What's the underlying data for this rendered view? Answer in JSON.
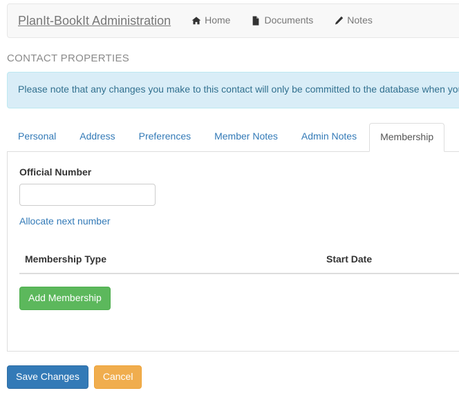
{
  "navbar": {
    "brand": "PlanIt-BookIt Administration",
    "links": [
      {
        "label": "Home",
        "icon": "home-icon"
      },
      {
        "label": "Documents",
        "icon": "file-icon"
      },
      {
        "label": "Notes",
        "icon": "pencil-icon"
      }
    ]
  },
  "page": {
    "title": "CONTACT PROPERTIES"
  },
  "alert": {
    "type": "info",
    "text": "Please note that any changes you make to this contact will only be committed to the database when you",
    "bg_color": "#d9edf7",
    "text_color": "#31708f"
  },
  "tabs": {
    "items": [
      {
        "label": "Personal",
        "active": false
      },
      {
        "label": "Address",
        "active": false
      },
      {
        "label": "Preferences",
        "active": false
      },
      {
        "label": "Member Notes",
        "active": false
      },
      {
        "label": "Admin Notes",
        "active": false
      },
      {
        "label": "Membership",
        "active": true
      }
    ],
    "active_label": "Membership"
  },
  "membership": {
    "official_number_label": "Official Number",
    "official_number_value": "",
    "official_number_placeholder": "",
    "allocate_link": "Allocate next number",
    "table": {
      "columns": [
        "Membership Type",
        "Start Date"
      ],
      "rows": []
    },
    "add_button": "Add Membership",
    "add_button_color": "#5cb85c"
  },
  "footer": {
    "save_label": "Save Changes",
    "save_color": "#337ab7",
    "cancel_label": "Cancel",
    "cancel_color": "#f0ad4e"
  }
}
